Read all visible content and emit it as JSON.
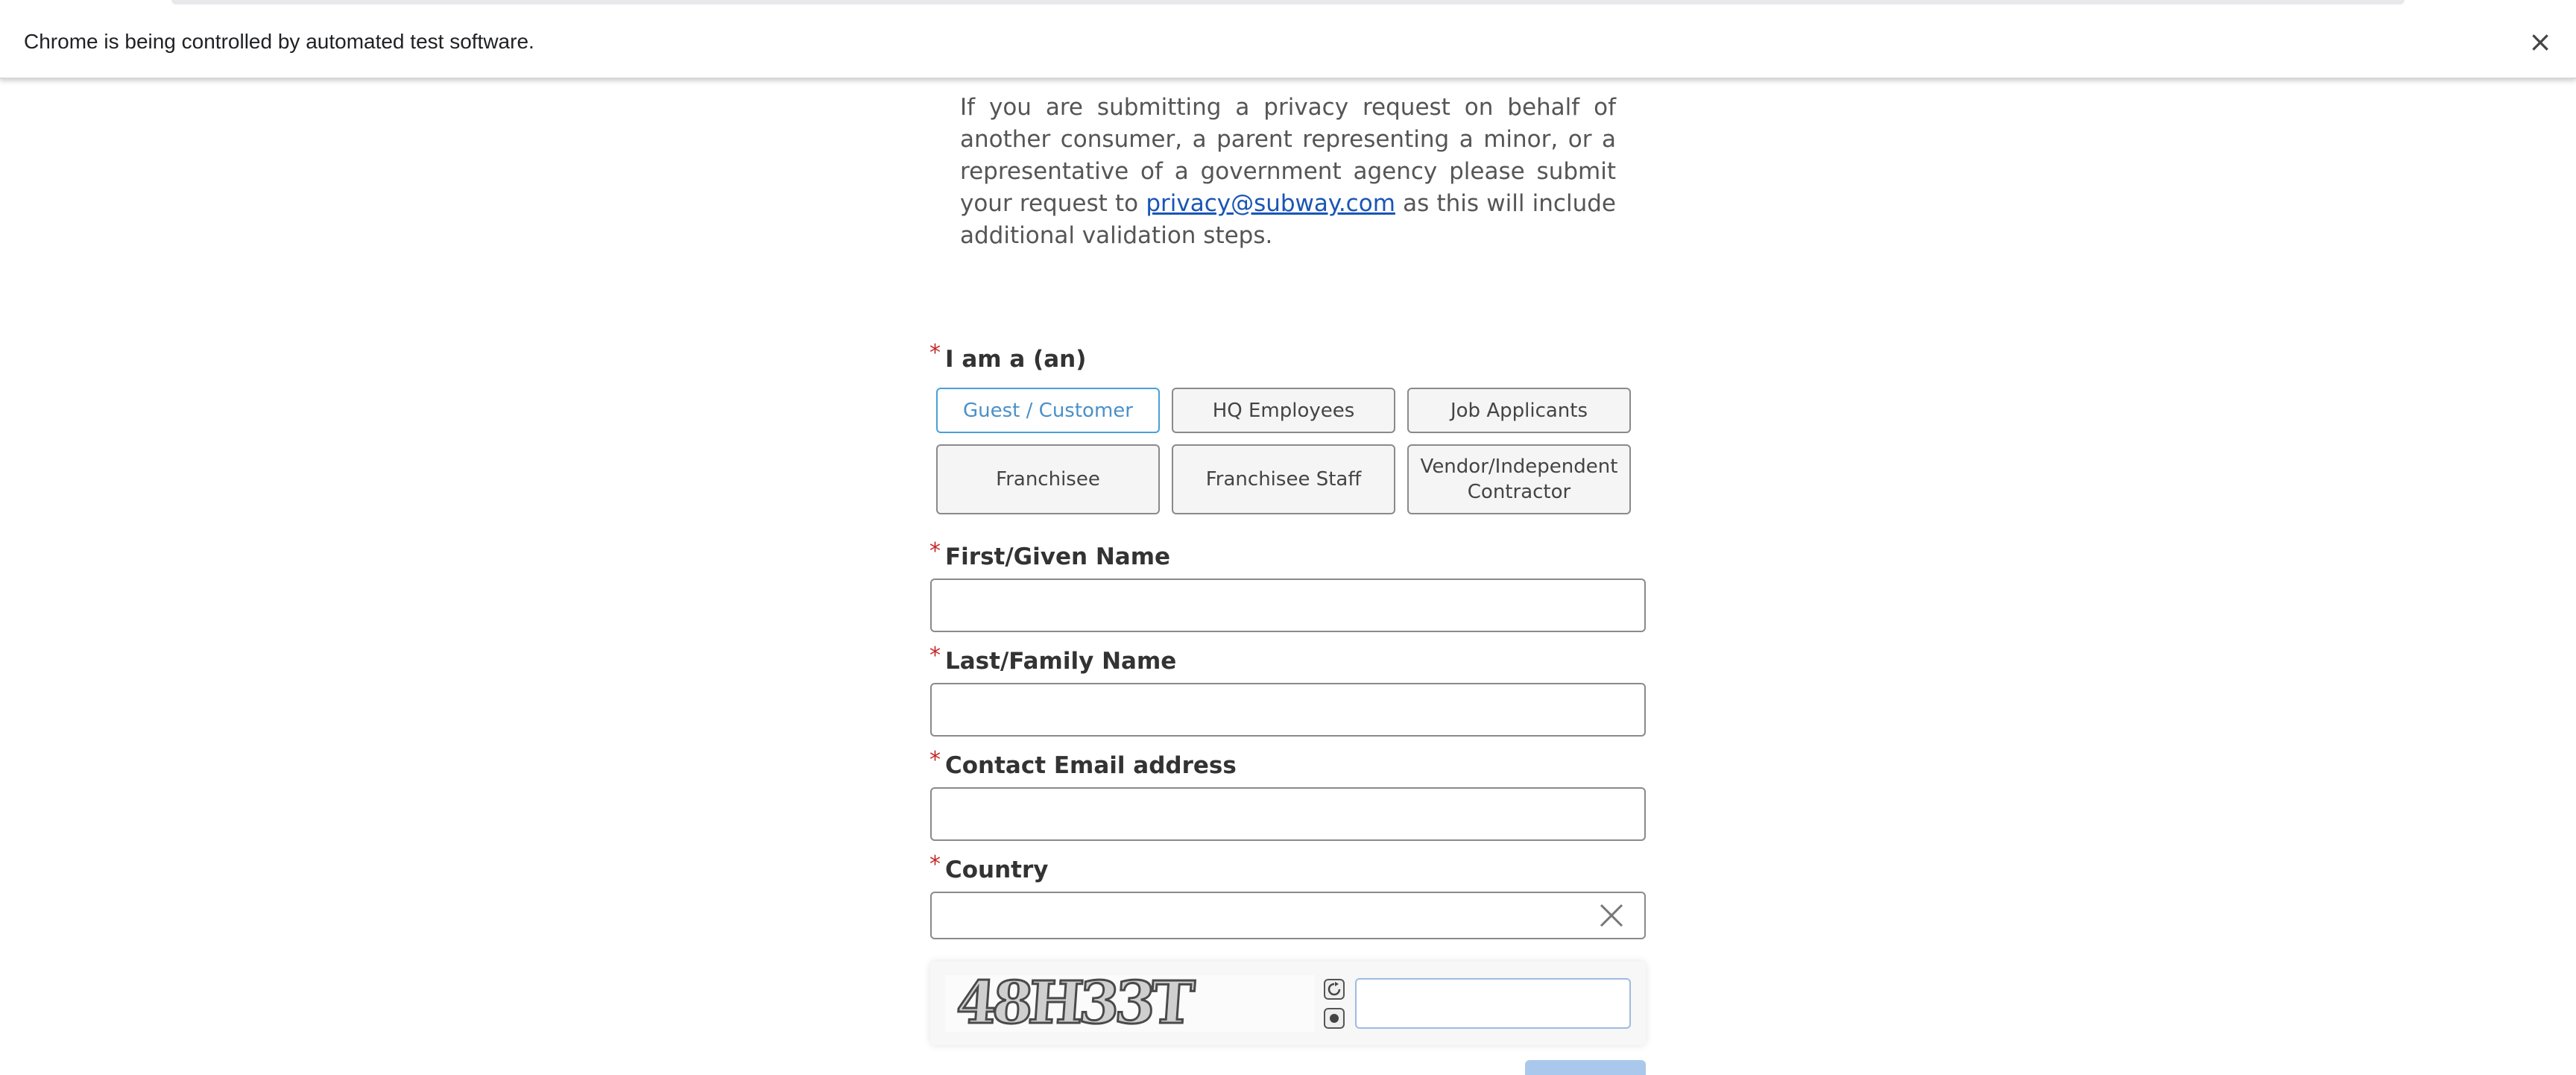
{
  "infobar": {
    "message": "Chrome is being controlled by automated test software.",
    "close_label": "×"
  },
  "intro": {
    "text_before": "If you are submitting a privacy request on behalf of another consumer, a parent representing a minor, or a representative of a government agency please submit your request to ",
    "email_link": "privacy@subway.com",
    "text_after": " as this will include additional validation steps."
  },
  "form": {
    "required_marker": "*",
    "requester_type": {
      "label": "I am a (an)",
      "options": [
        "Guest / Customer",
        "HQ Employees",
        "Job Applicants",
        "Franchisee",
        "Franchisee Staff",
        "Vendor/Independent Contractor"
      ],
      "selected": "Guest / Customer"
    },
    "first_name": {
      "label": "First/Given Name",
      "value": ""
    },
    "last_name": {
      "label": "Last/Family Name",
      "value": ""
    },
    "email": {
      "label": "Contact Email address",
      "value": ""
    },
    "country": {
      "label": "Country",
      "value": ""
    },
    "captcha": {
      "image_text": "48H33T",
      "value": ""
    }
  },
  "colors": {
    "link": "#1a55b5",
    "required": "#c62828",
    "selected_border": "#4aa0d6",
    "submit_disabled": "#a9c8ec"
  }
}
